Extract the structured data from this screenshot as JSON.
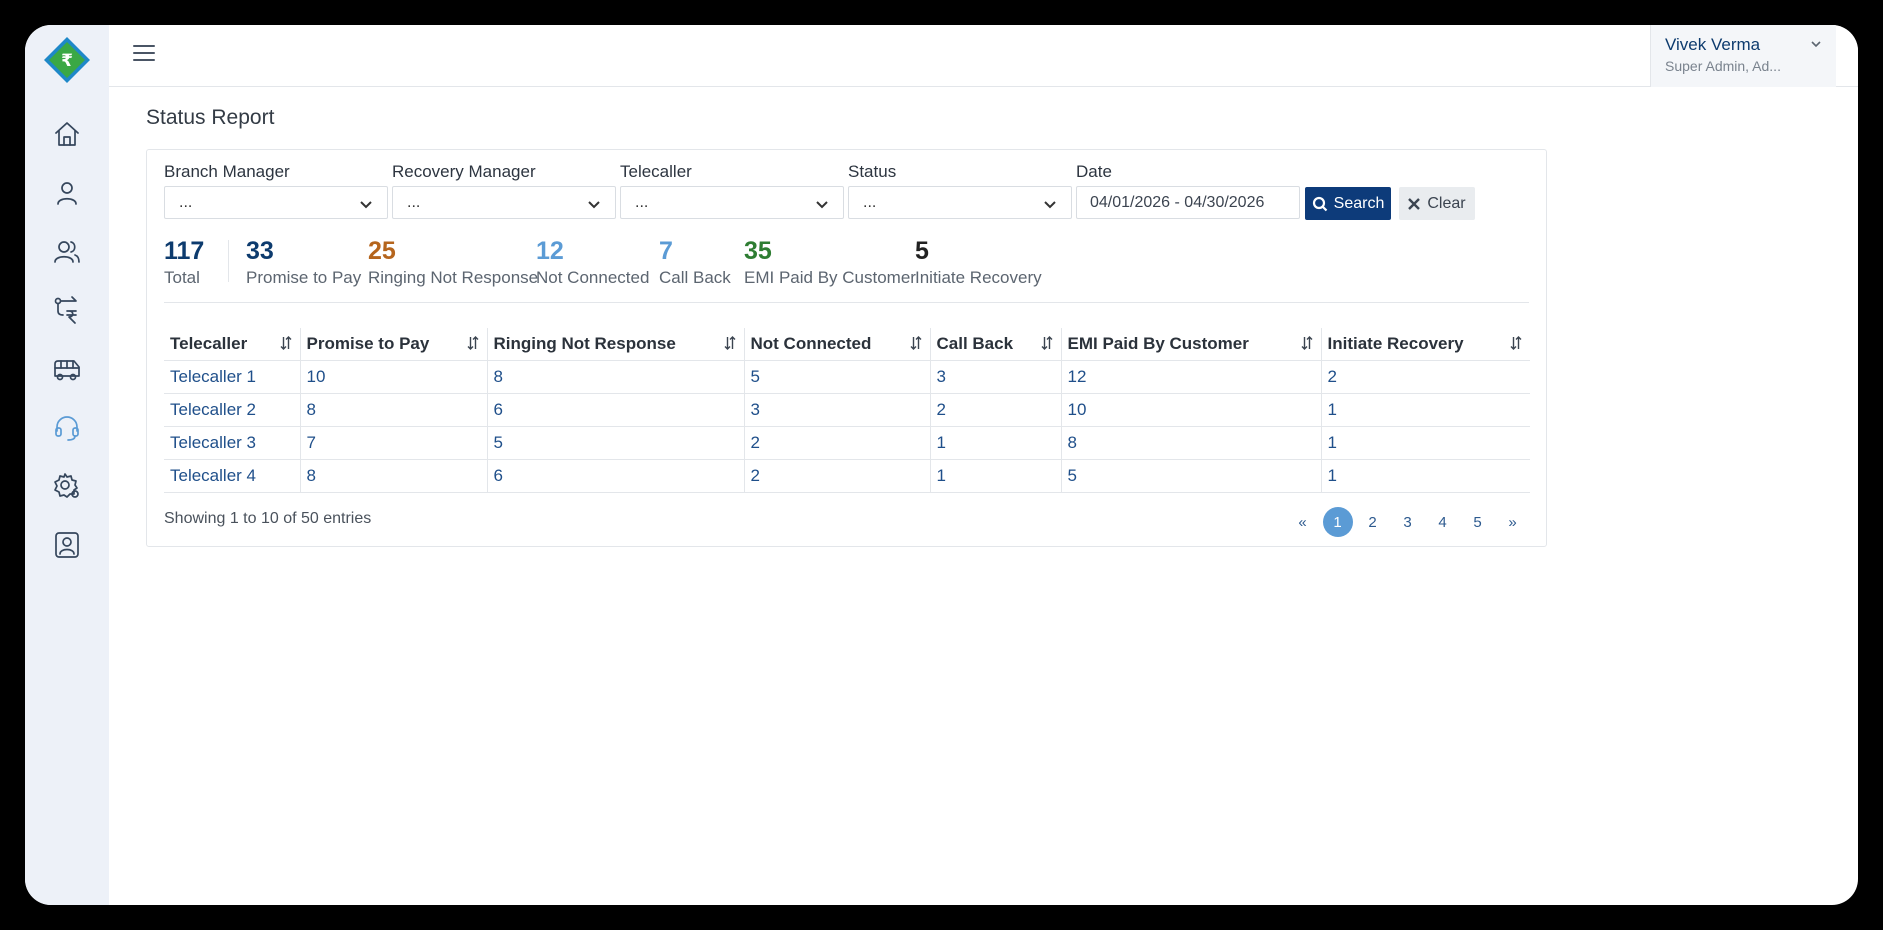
{
  "user": {
    "name": "Vivek Verma",
    "role": "Super Admin, Ad..."
  },
  "page_title": "Status Report",
  "filters": {
    "branch_manager": {
      "label": "Branch Manager",
      "value": "..."
    },
    "recovery_manager": {
      "label": "Recovery Manager",
      "value": "..."
    },
    "telecaller": {
      "label": "Telecaller",
      "value": "..."
    },
    "status": {
      "label": "Status",
      "value": "..."
    },
    "date": {
      "label": "Date",
      "value": "04/01/2026 - 04/30/2026"
    },
    "search_label": "Search",
    "clear_label": "Clear"
  },
  "stats": [
    {
      "value": "117",
      "label": "Total",
      "color": "#0d3b6e"
    },
    {
      "value": "33",
      "label": "Promise to Pay",
      "color": "#0d3b6e"
    },
    {
      "value": "25",
      "label": "Ringing Not Response",
      "color": "#b5651d"
    },
    {
      "value": "12",
      "label": "Not Connected",
      "color": "#5b9bd5"
    },
    {
      "value": "7",
      "label": "Call Back",
      "color": "#5b9bd5"
    },
    {
      "value": "35",
      "label": "EMI Paid By Customer",
      "color": "#2e7d32"
    },
    {
      "value": "5",
      "label": "Initiate Recovery",
      "color": "#222222"
    }
  ],
  "table": {
    "headers": [
      "Telecaller",
      "Promise to Pay",
      "Ringing Not Response",
      "Not Connected",
      "Call Back",
      "EMI Paid By Customer",
      "Initiate Recovery"
    ],
    "rows": [
      [
        "Telecaller 1",
        "10",
        "8",
        "5",
        "3",
        "12",
        "2"
      ],
      [
        "Telecaller 2",
        "8",
        "6",
        "3",
        "2",
        "10",
        "1"
      ],
      [
        "Telecaller 3",
        "7",
        "5",
        "2",
        "1",
        "8",
        "1"
      ],
      [
        "Telecaller 4",
        "8",
        "6",
        "2",
        "1",
        "5",
        "1"
      ]
    ]
  },
  "footer": {
    "info": "Showing 1 to 10 of 50 entries",
    "pagination": [
      "«",
      "1",
      "2",
      "3",
      "4",
      "5",
      "»"
    ],
    "active_page": "1"
  },
  "colors": {
    "primary": "#0d3b7a",
    "accent": "#5b9bd5",
    "sidebar_bg": "#edf1f8"
  }
}
